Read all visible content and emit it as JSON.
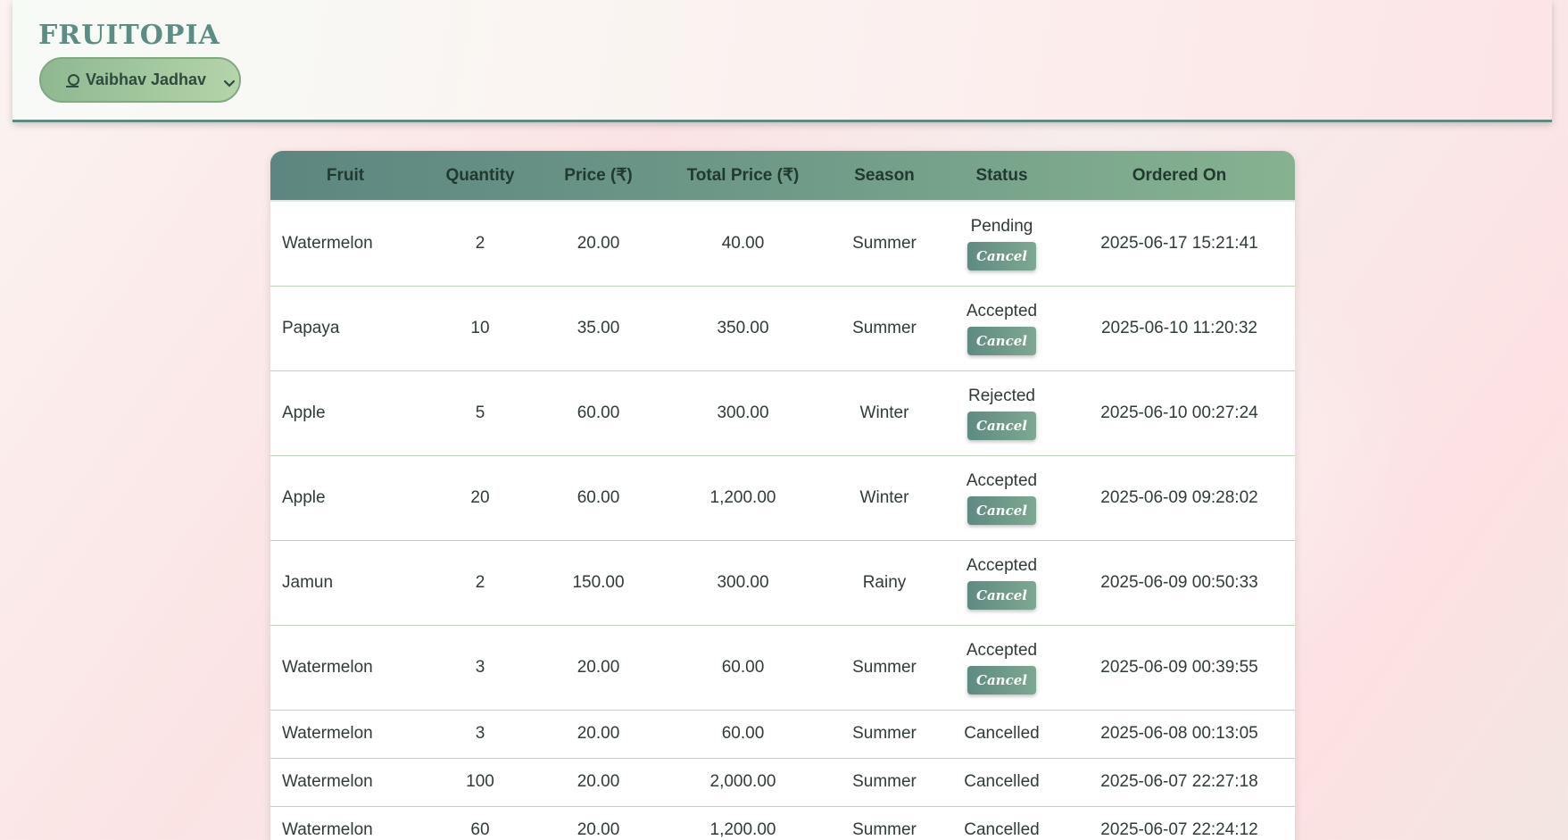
{
  "header": {
    "brand": "FRUITOPIA",
    "user_name": "Vaibhav Jadhav"
  },
  "table": {
    "columns": [
      "Fruit",
      "Quantity",
      "Price (₹)",
      "Total Price (₹)",
      "Season",
      "Status",
      "Ordered On"
    ],
    "cancel_label": "Cancel",
    "rows": [
      {
        "fruit": "Watermelon",
        "quantity": "2",
        "price": "20.00",
        "total": "40.00",
        "season": "Summer",
        "status": "Pending",
        "ordered_on": "2025-06-17 15:21:41",
        "cancel": "Cancel"
      },
      {
        "fruit": "Papaya",
        "quantity": "10",
        "price": "35.00",
        "total": "350.00",
        "season": "Summer",
        "status": "Accepted",
        "ordered_on": "2025-06-10 11:20:32",
        "cancel": "Cancel"
      },
      {
        "fruit": "Apple",
        "quantity": "5",
        "price": "60.00",
        "total": "300.00",
        "season": "Winter",
        "status": "Rejected",
        "ordered_on": "2025-06-10 00:27:24",
        "cancel": "Cancel"
      },
      {
        "fruit": "Apple",
        "quantity": "20",
        "price": "60.00",
        "total": "1,200.00",
        "season": "Winter",
        "status": "Accepted",
        "ordered_on": "2025-06-09 09:28:02",
        "cancel": "Cancel"
      },
      {
        "fruit": "Jamun",
        "quantity": "2",
        "price": "150.00",
        "total": "300.00",
        "season": "Rainy",
        "status": "Accepted",
        "ordered_on": "2025-06-09 00:50:33",
        "cancel": "Cancel"
      },
      {
        "fruit": "Watermelon",
        "quantity": "3",
        "price": "20.00",
        "total": "60.00",
        "season": "Summer",
        "status": "Accepted",
        "ordered_on": "2025-06-09 00:39:55",
        "cancel": "Cancel"
      },
      {
        "fruit": "Watermelon",
        "quantity": "3",
        "price": "20.00",
        "total": "60.00",
        "season": "Summer",
        "status": "Cancelled",
        "ordered_on": "2025-06-08 00:13:05"
      },
      {
        "fruit": "Watermelon",
        "quantity": "100",
        "price": "20.00",
        "total": "2,000.00",
        "season": "Summer",
        "status": "Cancelled",
        "ordered_on": "2025-06-07 22:27:18"
      },
      {
        "fruit": "Watermelon",
        "quantity": "60",
        "price": "20.00",
        "total": "1,200.00",
        "season": "Summer",
        "status": "Cancelled",
        "ordered_on": "2025-06-07 22:24:12"
      }
    ]
  }
}
